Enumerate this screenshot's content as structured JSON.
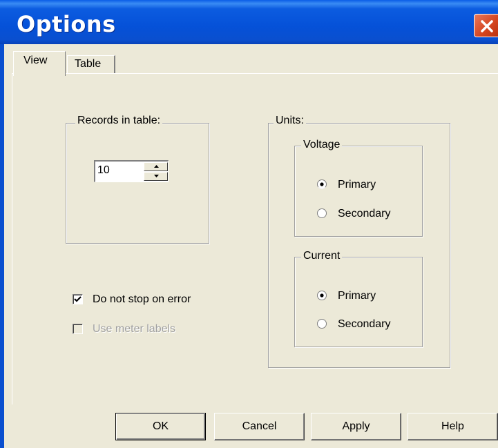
{
  "window": {
    "title": "Options"
  },
  "tabs": [
    {
      "label": "View",
      "active": true
    },
    {
      "label": "Table",
      "active": false
    }
  ],
  "records_group": {
    "legend": "Records in table:",
    "value": "10"
  },
  "options": {
    "stop_on_error": {
      "label": "Do not stop on error",
      "checked": true,
      "enabled": true
    },
    "meter_labels": {
      "label": "Use meter labels",
      "checked": false,
      "enabled": false
    }
  },
  "units": {
    "legend": "Units:",
    "voltage": {
      "legend": "Voltage",
      "options": [
        "Primary",
        "Secondary"
      ],
      "selected": "Primary"
    },
    "current": {
      "legend": "Current",
      "options": [
        "Primary",
        "Secondary"
      ],
      "selected": "Primary"
    }
  },
  "buttons": {
    "ok": "OK",
    "cancel": "Cancel",
    "apply": "Apply",
    "help": "Help"
  },
  "colors": {
    "title_bar": "#0551d8",
    "dialog_bg": "#ece9d8",
    "close_button": "#d4441e"
  }
}
